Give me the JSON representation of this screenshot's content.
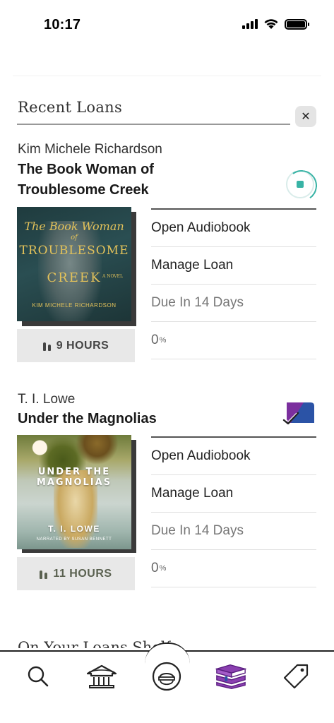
{
  "status_bar": {
    "time": "10:17"
  },
  "recent_loans": {
    "title": "Recent Loans",
    "close_label": "✕",
    "loans": [
      {
        "author": "Kim Michele Richardson",
        "title_line1": "The Book Woman of",
        "title_line2": "Troublesome Creek",
        "status": "in-progress",
        "cover": {
          "title_words": [
            "The Book Woman",
            "of",
            "TROUBLESOME",
            "CREEK"
          ],
          "subtitle": "A NOVEL",
          "author": "KIM MICHELE RICHARDSON"
        },
        "duration_label": "9 HOURS",
        "actions": {
          "open": "Open Audiobook",
          "manage": "Manage Loan",
          "due": "Due In 14 Days",
          "progress_value": "0",
          "progress_unit": "%"
        }
      },
      {
        "author": "T. I. Lowe",
        "title_line1": "Under the Magnolias",
        "status": "returned",
        "cover": {
          "title_line1": "UNDER  THE",
          "title_line2": "MAGNOLIAS",
          "author": "T. I. LOWE",
          "narrator": "NARRATED BY SUSAN BENNETT"
        },
        "duration_label": "11 HOURS",
        "actions": {
          "open": "Open Audiobook",
          "manage": "Manage Loan",
          "due": "Due In 14 Days",
          "progress_value": "0",
          "progress_unit": "%"
        }
      }
    ]
  },
  "next_section_title": "On Your Loans Shelf",
  "tab_bar": {
    "tabs": [
      "search-icon",
      "library-icon",
      "profile-icon",
      "books-icon",
      "tag-icon"
    ],
    "active": "books-icon",
    "active_color": "#8a3fb0"
  },
  "colors": {
    "accent_teal": "#38b3a5",
    "returned_badge_purple": "#7b2f9e",
    "returned_badge_blue": "#2b53a6"
  }
}
